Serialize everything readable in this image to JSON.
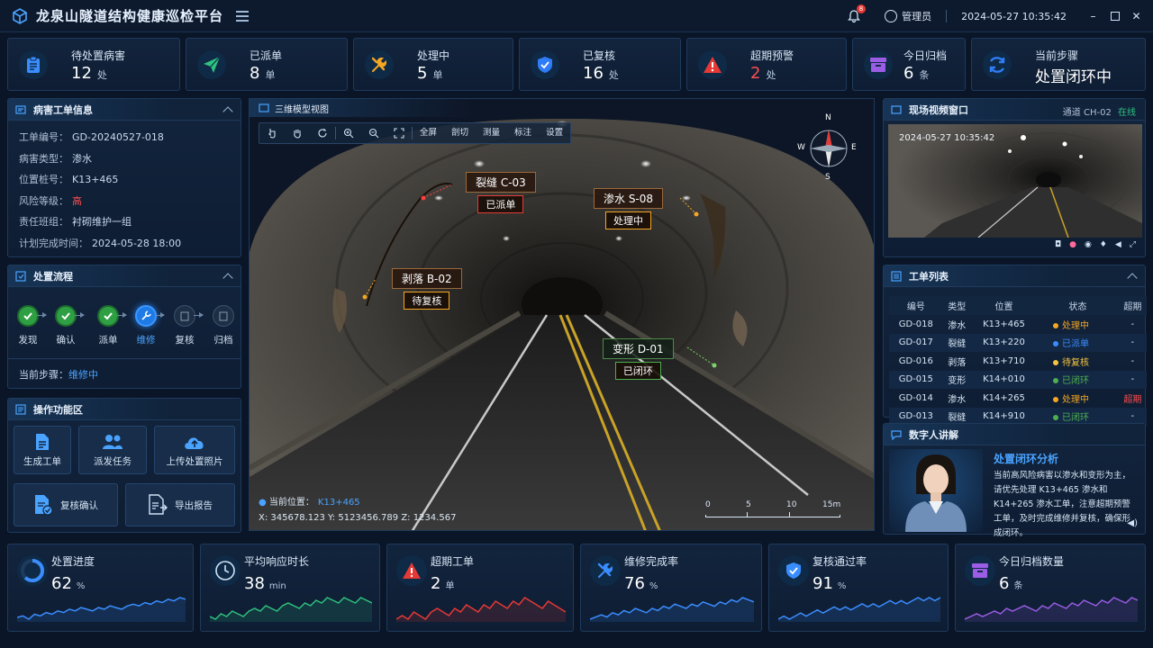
{
  "header": {
    "title": "龙泉山隧道结构健康巡检平台",
    "notif_count": "8",
    "user": "管理员",
    "datetime": "2024-05-27 10:35:42"
  },
  "stats": [
    {
      "label": "待处置病害",
      "value": "12",
      "unit": "处",
      "icon": "clipboard-icon",
      "color": "#3a8dff",
      "value_color": "#ffffff"
    },
    {
      "label": "已派单",
      "value": "8",
      "unit": "单",
      "icon": "send-icon",
      "color": "#2ec27e",
      "value_color": "#ffffff"
    },
    {
      "label": "处理中",
      "value": "5",
      "unit": "单",
      "icon": "tools-icon",
      "color": "#f5a623",
      "value_color": "#ffffff"
    },
    {
      "label": "已复核",
      "value": "16",
      "unit": "处",
      "icon": "shield-check-icon",
      "color": "#2f7cf6",
      "value_color": "#ffffff"
    },
    {
      "label": "超期预警",
      "value": "2",
      "unit": "处",
      "icon": "warning-icon",
      "color": "#e53935",
      "value_color": "#ff4d4f"
    },
    {
      "label": "今日归档",
      "value": "6",
      "unit": "条",
      "icon": "archive-icon",
      "color": "#9b5de5",
      "value_color": "#ffffff"
    },
    {
      "label": "当前步骤",
      "value": "处置闭环中",
      "unit": "",
      "icon": "refresh-icon",
      "color": "#2f7cf6",
      "value_color": "#ffffff"
    }
  ],
  "ticket": {
    "title": "病害工单信息",
    "rows": [
      {
        "k": "工单编号：",
        "v": "GD-20240527-018"
      },
      {
        "k": "病害类型：",
        "v": "渗水"
      },
      {
        "k": "位置桩号：",
        "v": "K13+465"
      },
      {
        "k": "风险等级：",
        "v": "高"
      },
      {
        "k": "责任班组：",
        "v": "衬砌维护一组"
      },
      {
        "k": "计划完成时间：",
        "v": "2024-05-28 18:00"
      }
    ]
  },
  "flow": {
    "title": "处置流程",
    "steps": [
      "发现",
      "确认",
      "派单",
      "维修",
      "复核",
      "归档"
    ],
    "current_label": "当前步骤：",
    "current_value": "维修中"
  },
  "ops": {
    "title": "操作功能区",
    "buttons": [
      "生成工单",
      "派发任务",
      "上传处置照片",
      "复核确认",
      "导出报告"
    ]
  },
  "view": {
    "title": "三维模型视图",
    "tools_text": [
      "全屏",
      "剖切",
      "测量",
      "标注",
      "设置"
    ],
    "compass": {
      "n": "N",
      "e": "E",
      "s": "S",
      "w": "W"
    },
    "labels": [
      {
        "name": "裂缝 C-03",
        "status": "已派单",
        "color": "#e53935"
      },
      {
        "name": "渗水 S-08",
        "status": "处理中",
        "color": "#f5a623"
      },
      {
        "name": "剥落 B-02",
        "status": "待复核",
        "color": "#f5a623"
      },
      {
        "name": "变形 D-01",
        "status": "已闭环",
        "color": "#4caf50"
      }
    ],
    "position_label": "当前位置：",
    "position_value": "K13+465",
    "coords": "X: 345678.123   Y: 5123456.789   Z: 1234.567",
    "scale_ticks": [
      "0",
      "5",
      "10",
      "15m"
    ]
  },
  "video": {
    "title": "现场视频窗口",
    "channel": "通道 CH-02",
    "status": "在线",
    "timestamp": "2024-05-27  10:35:42"
  },
  "worklist": {
    "title": "工单列表",
    "columns": [
      "编号",
      "类型",
      "位置",
      "状态",
      "超期"
    ],
    "rows": [
      {
        "id": "GD-018",
        "type": "渗水",
        "pos": "K13+465",
        "status": "处理中",
        "color": "#f5a623",
        "overdue": "-"
      },
      {
        "id": "GD-017",
        "type": "裂缝",
        "pos": "K13+220",
        "status": "已派单",
        "color": "#3a8dff",
        "overdue": "-"
      },
      {
        "id": "GD-016",
        "type": "剥落",
        "pos": "K13+710",
        "status": "待复核",
        "color": "#f5c542",
        "overdue": "-"
      },
      {
        "id": "GD-015",
        "type": "变形",
        "pos": "K14+010",
        "status": "已闭环",
        "color": "#4caf50",
        "overdue": "-"
      },
      {
        "id": "GD-014",
        "type": "渗水",
        "pos": "K14+265",
        "status": "处理中",
        "color": "#f5a623",
        "overdue": "超期"
      },
      {
        "id": "GD-013",
        "type": "裂缝",
        "pos": "K14+910",
        "status": "已闭环",
        "color": "#4caf50",
        "overdue": "-"
      }
    ]
  },
  "avatar": {
    "title": "数字人讲解",
    "heading": "处置闭环分析",
    "text": "当前高风险病害以渗水和变形为主，请优先处理 K13+465 渗水和 K14+265 渗水工单，注意超期预警工单，及时完成维修并复核，确保形成闭环。"
  },
  "kpis": [
    {
      "label": "处置进度",
      "value": "62",
      "unit": "%",
      "icon": "progress-ring-icon",
      "color": "#3a8dff",
      "spark": [
        8,
        9,
        7,
        10,
        9,
        11,
        10,
        12,
        11,
        13,
        12,
        14,
        13,
        12,
        14,
        13,
        15,
        14,
        13,
        15,
        16,
        15,
        17,
        16,
        18,
        17,
        19,
        18,
        20,
        19
      ]
    },
    {
      "label": "平均响应时长",
      "value": "38",
      "unit": "min",
      "icon": "clock-icon",
      "color": "#2ec27e",
      "spark": [
        10,
        9,
        11,
        10,
        12,
        11,
        10,
        12,
        13,
        12,
        14,
        13,
        12,
        14,
        15,
        14,
        13,
        15,
        14,
        16,
        15,
        17,
        16,
        15,
        17,
        16,
        15,
        17,
        16,
        15
      ]
    },
    {
      "label": "超期工单",
      "value": "2",
      "unit": "单",
      "icon": "warning-icon",
      "color": "#e53935",
      "spark": [
        9,
        10,
        9,
        11,
        10,
        9,
        11,
        12,
        11,
        10,
        12,
        11,
        13,
        12,
        11,
        13,
        12,
        14,
        13,
        12,
        14,
        13,
        15,
        14,
        13,
        12,
        14,
        13,
        12,
        11
      ]
    },
    {
      "label": "维修完成率",
      "value": "76",
      "unit": "%",
      "icon": "tools-icon",
      "color": "#3a8dff",
      "spark": [
        8,
        9,
        10,
        9,
        11,
        10,
        12,
        11,
        13,
        12,
        11,
        13,
        12,
        14,
        13,
        15,
        14,
        13,
        15,
        14,
        16,
        15,
        14,
        16,
        15,
        17,
        16,
        18,
        17,
        16
      ]
    },
    {
      "label": "复核通过率",
      "value": "91",
      "unit": "%",
      "icon": "shield-check-icon",
      "color": "#3a8dff",
      "spark": [
        9,
        10,
        9,
        10,
        11,
        10,
        11,
        12,
        11,
        12,
        13,
        12,
        13,
        12,
        13,
        14,
        13,
        14,
        13,
        14,
        15,
        14,
        15,
        14,
        15,
        16,
        15,
        16,
        15,
        16
      ]
    },
    {
      "label": "今日归档数量",
      "value": "6",
      "unit": "条",
      "icon": "archive-icon",
      "color": "#9b5de5",
      "spark": [
        8,
        9,
        10,
        9,
        10,
        11,
        10,
        12,
        11,
        12,
        13,
        12,
        11,
        13,
        12,
        14,
        13,
        12,
        14,
        13,
        15,
        14,
        13,
        15,
        14,
        16,
        15,
        14,
        16,
        15
      ]
    }
  ]
}
